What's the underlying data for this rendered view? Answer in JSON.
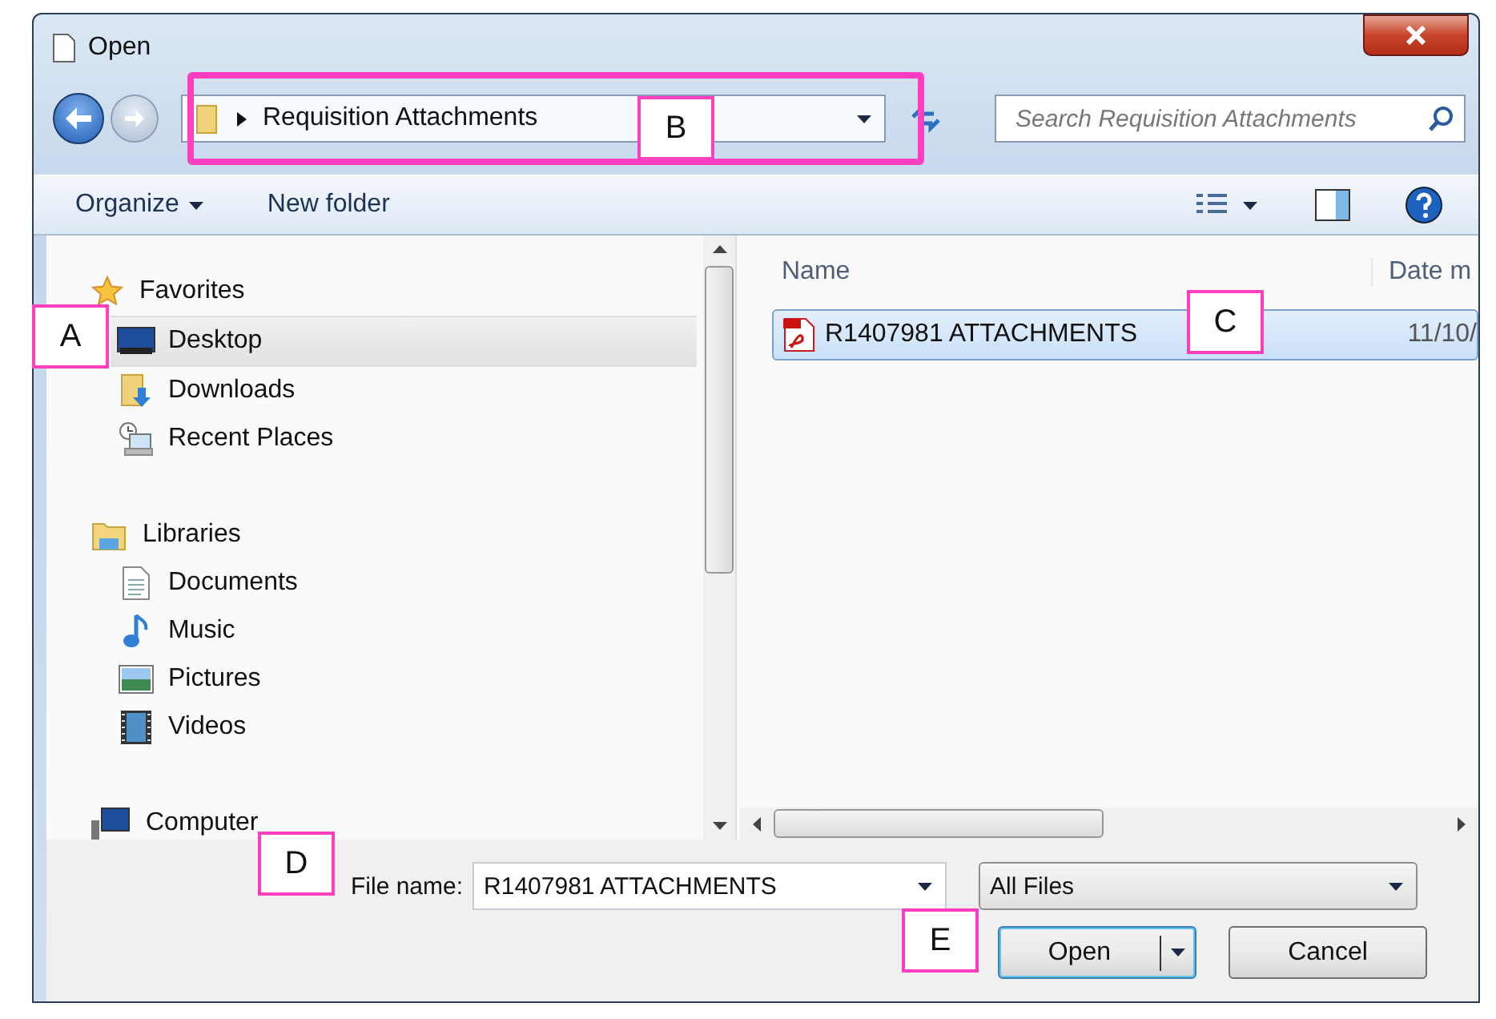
{
  "window": {
    "title": "Open"
  },
  "address_bar": {
    "path": "Requisition Attachments"
  },
  "search": {
    "placeholder": "Search Requisition Attachments"
  },
  "toolbar": {
    "organize": "Organize",
    "new_folder": "New folder"
  },
  "nav_pane": [
    {
      "label": "Favorites",
      "kind": "favorites",
      "selected": false,
      "children": [
        {
          "label": "Desktop",
          "kind": "desktop",
          "selected": true
        },
        {
          "label": "Downloads",
          "kind": "downloads",
          "selected": false
        },
        {
          "label": "Recent Places",
          "kind": "recent",
          "selected": false
        }
      ]
    },
    {
      "label": "Libraries",
      "kind": "libraries",
      "selected": false,
      "children": [
        {
          "label": "Documents",
          "kind": "documents",
          "selected": false
        },
        {
          "label": "Music",
          "kind": "music",
          "selected": false
        },
        {
          "label": "Pictures",
          "kind": "pictures",
          "selected": false
        },
        {
          "label": "Videos",
          "kind": "videos",
          "selected": false
        }
      ]
    },
    {
      "label": "Computer",
      "kind": "computer",
      "selected": false
    }
  ],
  "file_list": {
    "columns": [
      "Name",
      "Date m"
    ],
    "rows": [
      {
        "name": "R1407981 ATTACHMENTS",
        "date": "11/10/",
        "selected": true
      }
    ]
  },
  "file_name": {
    "label": "File name:",
    "value": "R1407981 ATTACHMENTS"
  },
  "file_type": {
    "value": "All Files"
  },
  "buttons": [
    {
      "label": "Open",
      "kind": "split"
    },
    {
      "label": "Cancel",
      "kind": "plain"
    }
  ],
  "callouts": [
    {
      "label": "A"
    },
    {
      "label": "B"
    },
    {
      "label": "C"
    },
    {
      "label": "D"
    },
    {
      "label": "E"
    }
  ]
}
